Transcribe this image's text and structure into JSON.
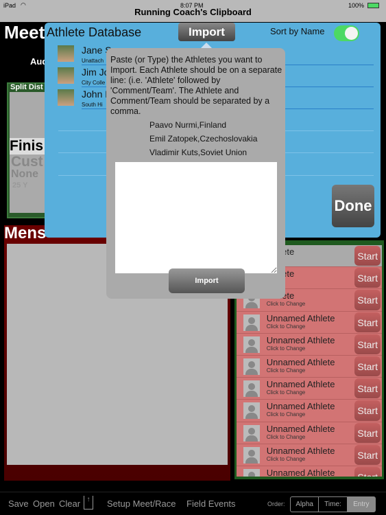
{
  "status_bar": {
    "device": "iPad",
    "time": "8:07 PM",
    "app_title": "Running Coach's Clipboard",
    "battery": "100%"
  },
  "background": {
    "meet_title": "Meet",
    "aud_label": "Aud",
    "split_label": "Split Dist",
    "finish": "Finis",
    "custom": "Cust",
    "none": "None",
    "yards": "25 Y",
    "mens_title": "Mens"
  },
  "right_list": {
    "rows": [
      {
        "name": "Athlete",
        "sub": ""
      },
      {
        "name": "Athlete",
        "sub": ""
      },
      {
        "name": "Athlete",
        "sub": "Click to Change"
      },
      {
        "name": "Unnamed Athlete",
        "sub": "Click to Change"
      },
      {
        "name": "Unnamed Athlete",
        "sub": "Click to Change"
      },
      {
        "name": "Unnamed Athlete",
        "sub": "Click to Change"
      },
      {
        "name": "Unnamed Athlete",
        "sub": "Click to Change"
      },
      {
        "name": "Unnamed Athlete",
        "sub": "Click to Change"
      },
      {
        "name": "Unnamed Athlete",
        "sub": "Click to Change"
      },
      {
        "name": "Unnamed Athlete",
        "sub": "Click to Change"
      },
      {
        "name": "Unnamed Athlete",
        "sub": ""
      }
    ],
    "start_label": "Start"
  },
  "athlete_db": {
    "title": "Athlete Database",
    "import_tab": "Import",
    "sort_label": "Sort by Name",
    "sort_on": true,
    "done_label": "Done",
    "athletes": [
      {
        "name": "Jane S",
        "team": "Unattach"
      },
      {
        "name": "Jim Jo",
        "team": "City Colle"
      },
      {
        "name": "John D",
        "team": "South Hi"
      }
    ]
  },
  "import_dialog": {
    "instructions": "Paste (or Type) the Athletes you want to Import. Each Athlete should be on a separate line: (i.e. 'Athlete' followed by 'Comment/Team'. The Athlete and Comment/Team should be separated by a comma.",
    "examples": [
      "Paavo Nurmi,Finland",
      "Emil Zatopek,Czechoslovakia",
      "Vladimir Kuts,Soviet Union"
    ],
    "textarea_value": "",
    "import_button": "Import"
  },
  "toolbar": {
    "save": "Save",
    "open": "Open",
    "clear": "Clear",
    "setup": "Setup Meet/Race",
    "field_events": "Field Events",
    "order_label": "Order:",
    "order_options": [
      "Alpha",
      "Time:",
      "Entry"
    ],
    "order_selected": "Entry"
  }
}
